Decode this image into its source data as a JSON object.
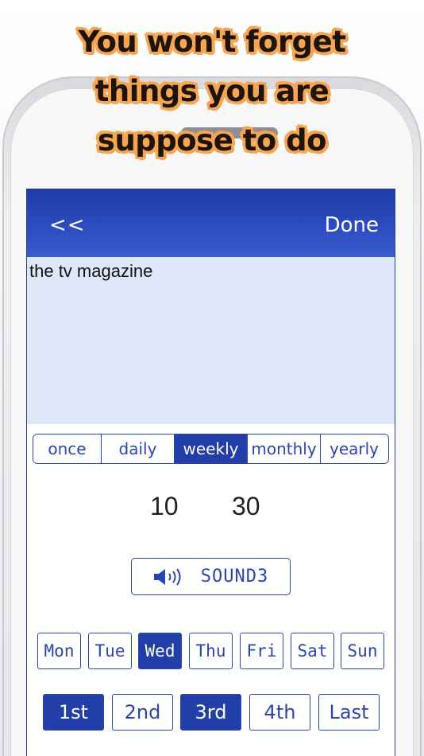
{
  "promo": {
    "line1": "You won't forget",
    "line2": "things you are",
    "line3": "suppose to do"
  },
  "navbar": {
    "back_label": "<<",
    "done_label": "Done",
    "color": "#2a46b8"
  },
  "memo": {
    "text": "the tv magazine"
  },
  "frequency": {
    "options": [
      "once",
      "daily",
      "weekly",
      "monthly",
      "yearly"
    ],
    "selected": "weekly"
  },
  "time": {
    "hour": "10",
    "minute": "30"
  },
  "sound": {
    "icon": "speaker-icon",
    "label": "SOUND3"
  },
  "days": {
    "items": [
      "Mon",
      "Tue",
      "Wed",
      "Thu",
      "Fri",
      "Sat",
      "Sun"
    ],
    "selected": [
      "Wed"
    ]
  },
  "weeks": {
    "items": [
      "1st",
      "2nd",
      "3rd",
      "4th",
      "Last"
    ],
    "selected": [
      "1st",
      "3rd"
    ]
  },
  "colors": {
    "accent": "#223ea9",
    "memo_bg": "#dde7f7",
    "promo_outline": "#f6a552"
  }
}
